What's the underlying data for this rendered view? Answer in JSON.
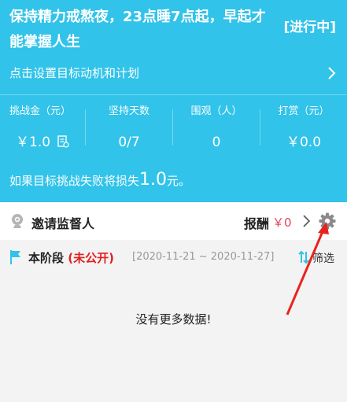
{
  "header": {
    "title": "保持精力戒熬夜，23点睡7点起，早起才能掌握人生",
    "status": "[进行中]",
    "plan_link": "点击设置目标动机和计划"
  },
  "stats": [
    {
      "label": "挑战金（元）",
      "value": "￥1.0"
    },
    {
      "label": "坚持天数",
      "value": "0/7"
    },
    {
      "label": "围观（人）",
      "value": "0"
    },
    {
      "label": "打赏（元）",
      "value": "￥0.0"
    }
  ],
  "loss": {
    "prefix": "如果目标挑战失败将损失",
    "amount": "1.0",
    "suffix": "元。"
  },
  "invite": {
    "label": "邀请监督人",
    "reward_label": "报酬",
    "reward_value": "￥0"
  },
  "stage": {
    "title": "本阶段",
    "privacy": "(未公开)",
    "date_range": "[2020-11-21 ~ 2020-11-27]",
    "filter_label": "筛选"
  },
  "empty_message": "没有更多数据!",
  "colors": {
    "header_bg": "#31c3e9",
    "reward_red": "#e0435a",
    "private_red": "#e02020",
    "arrow_red": "#e8231e"
  }
}
